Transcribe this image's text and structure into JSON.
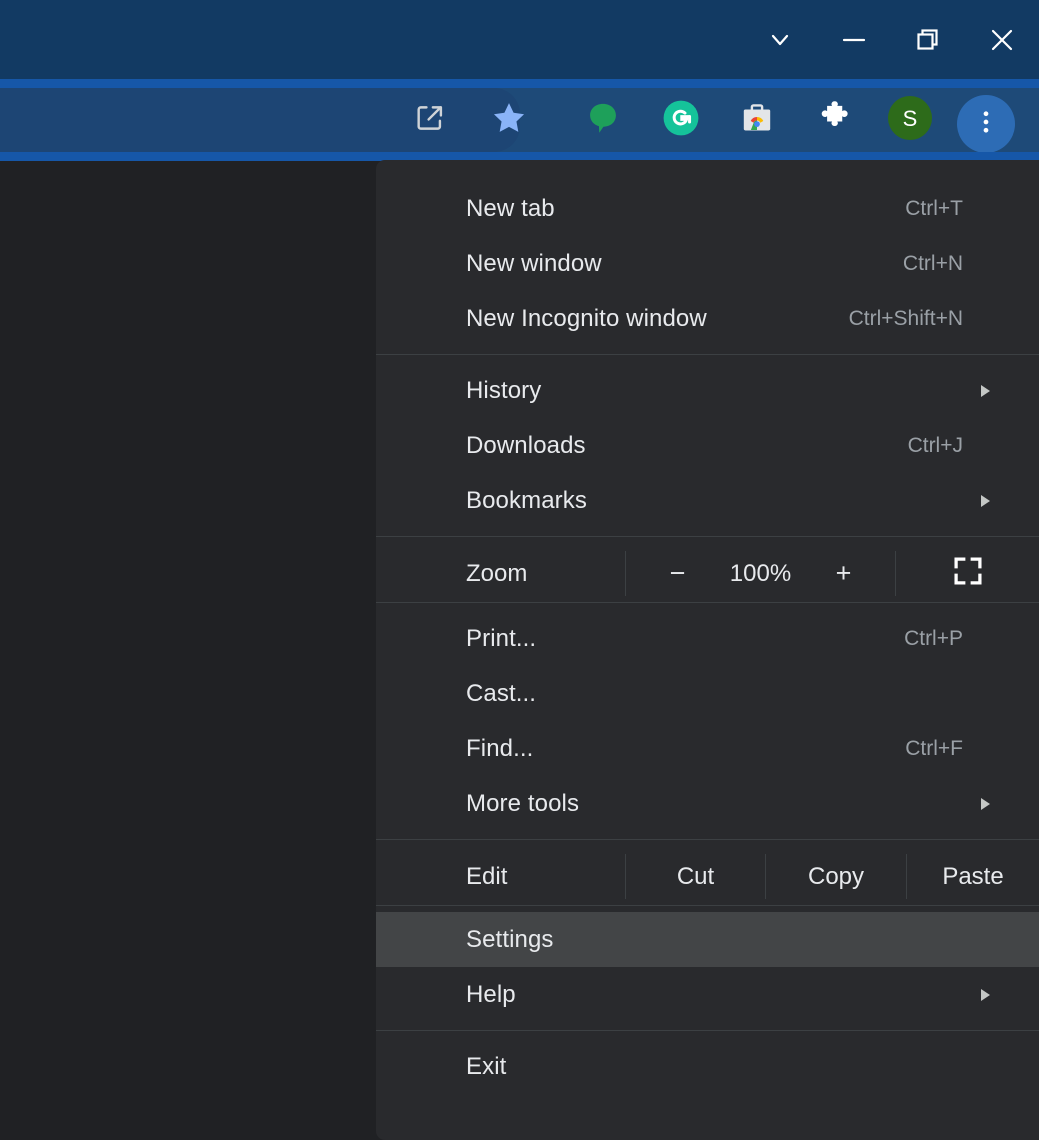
{
  "window_controls": [
    {
      "name": "tab-search",
      "icon": "chevron-down-icon"
    },
    {
      "name": "minimize",
      "icon": "minimize-icon"
    },
    {
      "name": "restore",
      "icon": "restore-icon"
    },
    {
      "name": "close",
      "icon": "close-icon"
    }
  ],
  "toolbar": {
    "icons": [
      {
        "name": "share-icon",
        "label": "Share"
      },
      {
        "name": "bookmark-star-icon",
        "label": "Bookmark this tab",
        "color": "#8ab4f8"
      },
      {
        "name": "chat-bubble-extension-icon",
        "label": "Chat extension",
        "color": "#1ea05a"
      },
      {
        "name": "grammarly-extension-icon",
        "label": "Grammarly",
        "letter": "G",
        "color": "#15c39a"
      },
      {
        "name": "chrome-web-store-icon",
        "label": "Chrome Web Store",
        "color": "#dadce0"
      },
      {
        "name": "extensions-puzzle-icon",
        "label": "Extensions",
        "color": "#ffffff"
      },
      {
        "name": "profile-avatar",
        "label": "Profile",
        "letter": "S",
        "color": "#2d6b1a"
      },
      {
        "name": "three-dot-menu-icon",
        "label": "Customize and control Google Chrome",
        "color": "#2d6cb5"
      }
    ]
  },
  "menu": {
    "group1": [
      {
        "label": "New tab",
        "accel": "Ctrl+T",
        "name": "menu-item-new-tab"
      },
      {
        "label": "New window",
        "accel": "Ctrl+N",
        "name": "menu-item-new-window"
      },
      {
        "label": "New Incognito window",
        "accel": "Ctrl+Shift+N",
        "name": "menu-item-new-incognito-window"
      }
    ],
    "group2": [
      {
        "label": "History",
        "accel": "",
        "submenu": true,
        "name": "menu-item-history"
      },
      {
        "label": "Downloads",
        "accel": "Ctrl+J",
        "submenu": false,
        "name": "menu-item-downloads"
      },
      {
        "label": "Bookmarks",
        "accel": "",
        "submenu": true,
        "name": "menu-item-bookmarks"
      }
    ],
    "zoom": {
      "label": "Zoom",
      "minus": "−",
      "value": "100%",
      "plus": "+",
      "fullscreen_icon": "fullscreen-icon"
    },
    "group3": [
      {
        "label": "Print...",
        "accel": "Ctrl+P",
        "submenu": false,
        "name": "menu-item-print"
      },
      {
        "label": "Cast...",
        "accel": "",
        "submenu": false,
        "name": "menu-item-cast"
      },
      {
        "label": "Find...",
        "accel": "Ctrl+F",
        "submenu": false,
        "name": "menu-item-find"
      },
      {
        "label": "More tools",
        "accel": "",
        "submenu": true,
        "name": "menu-item-more-tools"
      }
    ],
    "edit": {
      "label": "Edit",
      "cut": "Cut",
      "copy": "Copy",
      "paste": "Paste"
    },
    "group4": [
      {
        "label": "Settings",
        "accel": "",
        "submenu": false,
        "selected": true,
        "name": "menu-item-settings"
      },
      {
        "label": "Help",
        "accel": "",
        "submenu": true,
        "selected": false,
        "name": "menu-item-help"
      }
    ],
    "group5": [
      {
        "label": "Exit",
        "accel": "",
        "submenu": false,
        "name": "menu-item-exit"
      }
    ]
  },
  "colors": {
    "titlebar": "#123a63",
    "band": "#1657a8",
    "toolbar": "#1e4a78",
    "menu_bg": "#292a2d",
    "menu_selected": "#434547",
    "text": "#e8eaed",
    "accel_text": "#9aa0a6"
  }
}
